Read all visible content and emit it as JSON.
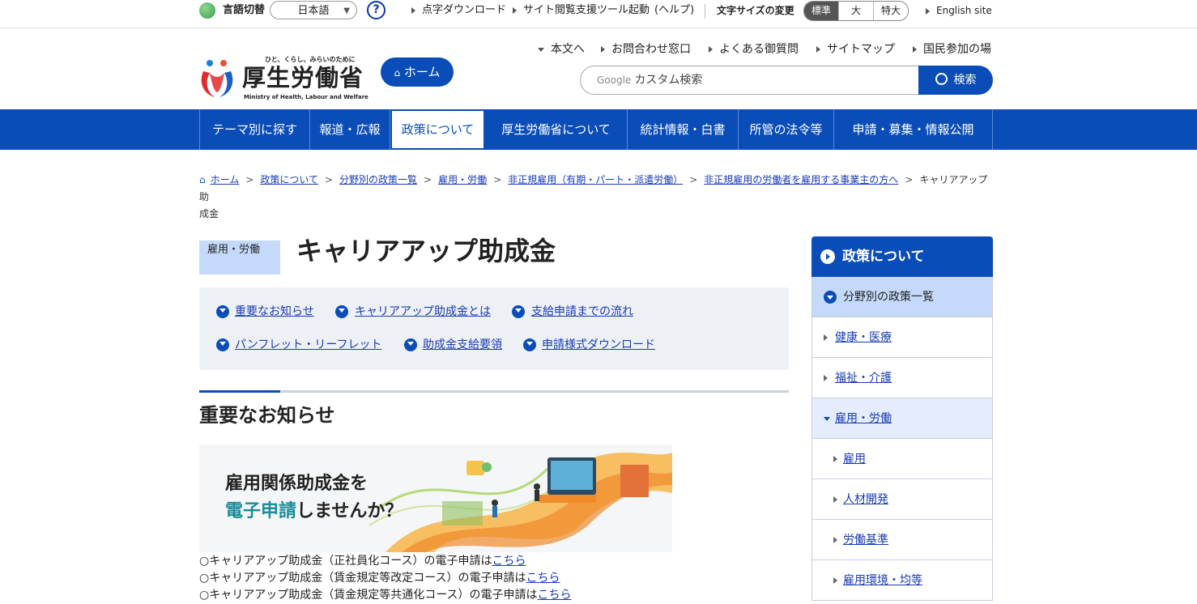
{
  "topbar": {
    "lang_label": "言語切替",
    "lang_value": "日本語",
    "help_icon": "?",
    "links": [
      "点字ダウンロード",
      "サイト閲覧支援ツール起動",
      "(ヘルプ)"
    ],
    "fontsize_label": "文字サイズの変更",
    "fontsize_options": [
      "標準",
      "大",
      "特大"
    ],
    "english": "English site"
  },
  "header": {
    "logo_tagline": "ひと、くらし、みらいのために",
    "logo_name": "厚生労働省",
    "logo_en": "Ministry of Health, Labour and Welfare",
    "home_button": "ホーム",
    "links": [
      "本文へ",
      "お問合わせ窓口",
      "よくある御質問",
      "サイトマップ",
      "国民参加の場"
    ],
    "search_brand": "Google",
    "search_placeholder": "カスタム検索",
    "search_button": "検索"
  },
  "gnav": [
    "テーマ別に探す",
    "報道・広報",
    "政策について",
    "厚生労働省について",
    "統計情報・白書",
    "所管の法令等",
    "申請・募集・情報公開"
  ],
  "breadcrumb": {
    "items": [
      "ホーム",
      "政策について",
      "分野別の政策一覧",
      "雇用・労働",
      "非正規雇用（有期・パート・派遣労働）",
      "非正規雇用の労働者を雇用する事業主の方へ"
    ],
    "current_a": "キャリアアップ助",
    "current_b": "成金",
    "separator": ">"
  },
  "page": {
    "category": "雇用・労働",
    "title": "キャリアアップ助成金"
  },
  "toc": [
    "重要なお知らせ",
    "キャリアアップ助成金とは",
    "支給申請までの流れ",
    "パンフレット・リーフレット",
    "助成金支給要領",
    "申請様式ダウンロード"
  ],
  "section": {
    "title": "重要なお知らせ",
    "banner_line1": "雇用関係助成金を",
    "banner_line2_teal": "電子申請",
    "banner_line2_rest": "しませんか？",
    "notes": [
      {
        "text": "○キャリアアップ助成金（正社員化コース）の電子申請は",
        "link": "こちら"
      },
      {
        "text": "○キャリアアップ助成金（賃金規定等改定コース）の電子申請は",
        "link": "こちら"
      },
      {
        "text": "○キャリアアップ助成金（賃金規定等共通化コース）の電子申請は",
        "link": "こちら"
      }
    ]
  },
  "sidebar": {
    "title": "政策について",
    "sub": "分野別の政策一覧",
    "items": [
      "健康・医療",
      "福祉・介護",
      "雇用・労働"
    ],
    "subitems": [
      "雇用",
      "人材開発",
      "労働基準",
      "雇用環境・均等"
    ]
  },
  "colors": {
    "brand": "#0b4db8",
    "light": "#c5dafa",
    "teal": "#1a8c9a"
  }
}
